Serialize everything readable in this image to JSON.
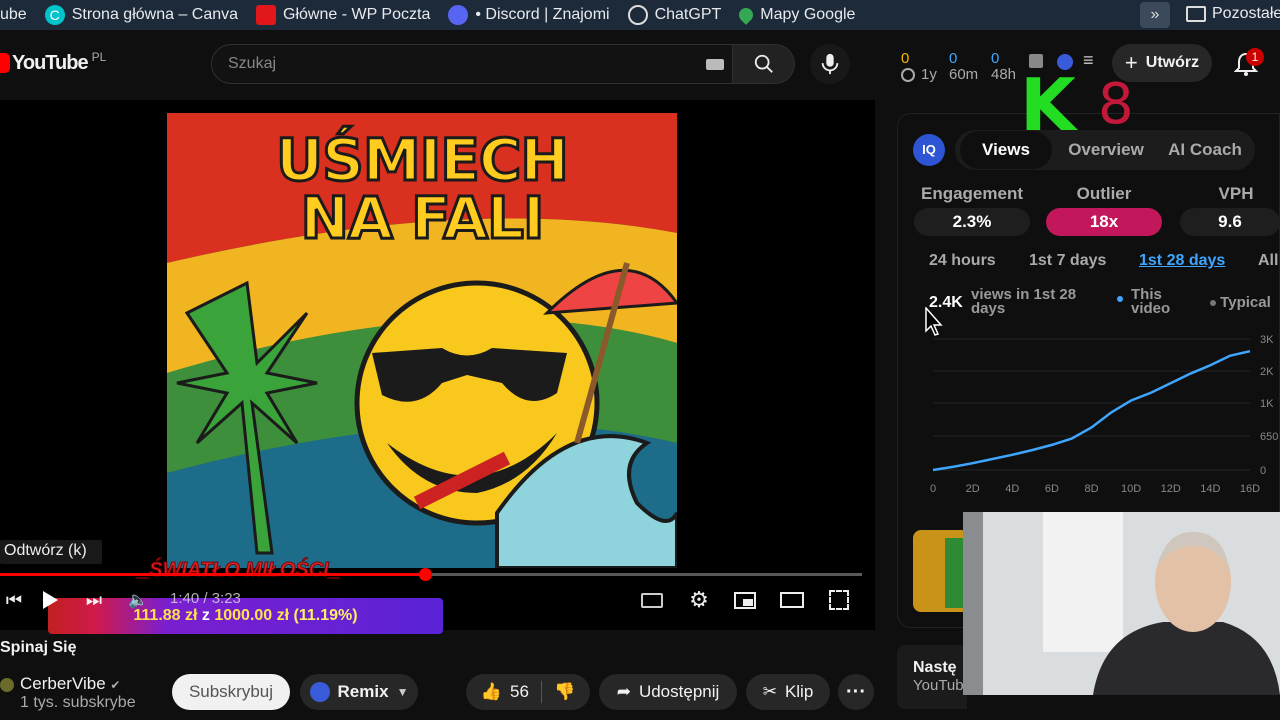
{
  "bookmarks": {
    "items": [
      {
        "label": "ube",
        "icon": "tab-fragment"
      },
      {
        "label": "Strona główna – Canva",
        "icon": "canva-icon",
        "color": "#00c4cc"
      },
      {
        "label": "Główne - WP Poczta",
        "icon": "wp-icon",
        "color": "#e2171b"
      },
      {
        "label": "• Discord | Znajomi",
        "icon": "discord-icon",
        "color": "#5865f2"
      },
      {
        "label": "ChatGPT",
        "icon": "chatgpt-icon",
        "color": "#ffffff"
      },
      {
        "label": "Mapy Google",
        "icon": "maps-pin-icon",
        "color": "#34a853"
      }
    ],
    "overflow_label": "Pozostałe"
  },
  "header": {
    "logo_text": "YouTube",
    "region": "PL",
    "search_placeholder": "Szukaj",
    "create_label": "Utwórz",
    "notification_count": "1",
    "ext_counts": [
      "0",
      "0",
      "0"
    ],
    "ext_times": [
      "1y",
      "60m",
      "48h"
    ]
  },
  "overlay": {
    "k_label": "K",
    "k_number": "8"
  },
  "player": {
    "thumbnail_title_line1": "UŚMIECH",
    "thumbnail_title_line2": "NA FALI",
    "tooltip": "Odtwórz (k)",
    "song_overlay": "_ŚWIATŁO MIŁOŚCI_",
    "time": "1:40 / 3:23",
    "progress_fraction": 0.493,
    "donation_amount": "111.88 zł",
    "donation_of": "z",
    "donation_goal": "1000.00 zł",
    "donation_percent": "(11.19%)"
  },
  "video": {
    "title": "Spinaj Się",
    "channel": "CerberVibe",
    "subscribers": "1 tys. subskrybe",
    "subscribe_label": "Subskrybuj",
    "remix_label": "Remix",
    "likes": "56",
    "share_label": "Udostępnij",
    "clip_label": "Klip"
  },
  "panel": {
    "tabs": [
      "Views",
      "Overview",
      "AI Coach"
    ],
    "active_tab": "Views",
    "metrics": [
      {
        "label": "Engagement",
        "value": "2.3%"
      },
      {
        "label": "Outlier",
        "value": "18x"
      },
      {
        "label": "VPH",
        "value": "9.6"
      }
    ],
    "periods": [
      "24 hours",
      "1st 7 days",
      "1st 28 days",
      "All"
    ],
    "active_period": "1st 28 days",
    "summary_value": "2.4K",
    "summary_text_1": "views in 1st 28",
    "summary_text_2": "days",
    "legend_this_1": "This",
    "legend_this_2": "video",
    "legend_typical": "Typical",
    "accent": "#3ea6ff",
    "outlier_color": "#c2185b"
  },
  "up_next": {
    "label": "Nastę",
    "subtitle": "YouTube Mix"
  },
  "chart_data": {
    "type": "line",
    "x": [
      0,
      10,
      20,
      30,
      40,
      50,
      60,
      70,
      80,
      90,
      100,
      110,
      120,
      130,
      140,
      150,
      160
    ],
    "series": [
      {
        "name": "This video",
        "values": [
          0,
          60,
          130,
          210,
          290,
          380,
          480,
          600,
          740,
          900,
          1080,
          1320,
          1620,
          1920,
          2180,
          2480,
          2620
        ]
      }
    ],
    "xticks": [
      "0",
      "2D",
      "4D",
      "6D",
      "8D",
      "10D",
      "12D",
      "14D",
      "16D"
    ],
    "yticks": [
      "0",
      "650",
      "1K",
      "2K",
      "3K"
    ],
    "ylim": [
      0,
      3000
    ],
    "xlim": [
      0,
      160
    ],
    "grid": true
  }
}
